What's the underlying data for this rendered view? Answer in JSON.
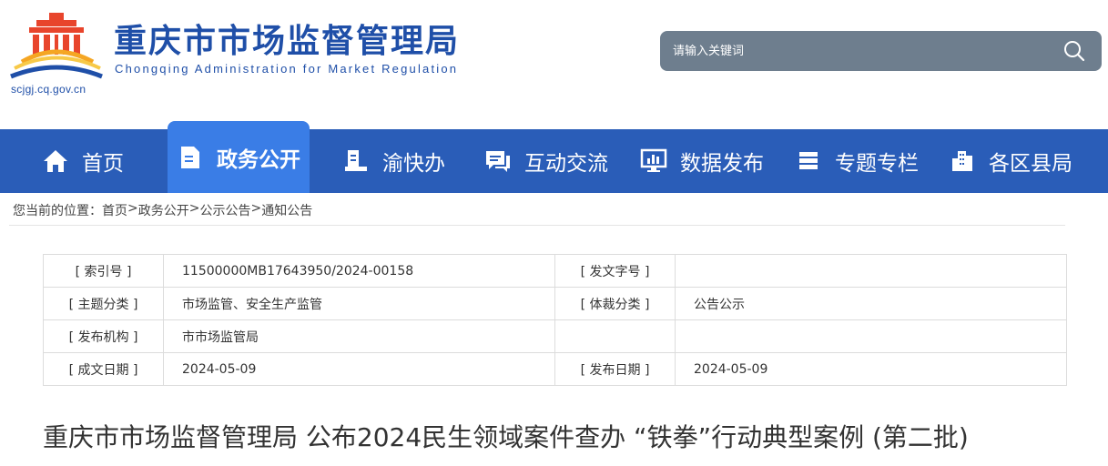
{
  "header": {
    "title_cn": "重庆市市场监督管理局",
    "title_en": "Chongqing Administration for Market Regulation",
    "site_url": "scjgj.cq.gov.cn"
  },
  "search": {
    "placeholder": "请输入关键词"
  },
  "nav": {
    "items": [
      {
        "label": "首页",
        "icon": "home-icon"
      },
      {
        "label": "政务公开",
        "icon": "document-icon",
        "active": true
      },
      {
        "label": "渝快办",
        "icon": "desk-icon"
      },
      {
        "label": "互动交流",
        "icon": "chat-icon"
      },
      {
        "label": "数据发布",
        "icon": "monitor-chart-icon"
      },
      {
        "label": "专题专栏",
        "icon": "stack-icon"
      },
      {
        "label": "各区县局",
        "icon": "buildings-icon"
      }
    ]
  },
  "breadcrumb": {
    "prefix": "您当前的位置：",
    "items": [
      "首页",
      "政务公开",
      "公示公告",
      "通知公告"
    ],
    "separator": ">"
  },
  "info": {
    "rows": [
      {
        "l1": "[ 索引号 ]",
        "v1": "11500000MB17643950/2024-00158",
        "l2": "[ 发文字号 ]",
        "v2": ""
      },
      {
        "l1": "[ 主题分类 ]",
        "v1": "市场监管、安全生产监管",
        "l2": "[ 体裁分类 ]",
        "v2": "公告公示"
      },
      {
        "l1": "[ 发布机构 ]",
        "v1": "市市场监管局",
        "l2": "",
        "v2": ""
      },
      {
        "l1": "[ 成文日期 ]",
        "v1": "2024-05-09",
        "l2": "[ 发布日期 ]",
        "v2": "2024-05-09"
      }
    ]
  },
  "article": {
    "title": "重庆市市场监督管理局 公布2024民生领域案件查办 “铁拳”行动典型案例 (第二批)"
  },
  "colors": {
    "brand_blue": "#1f4fa8",
    "nav_bg": "#2a5db8",
    "nav_active": "#3a7de6",
    "search_bg": "#6e7e8e"
  }
}
